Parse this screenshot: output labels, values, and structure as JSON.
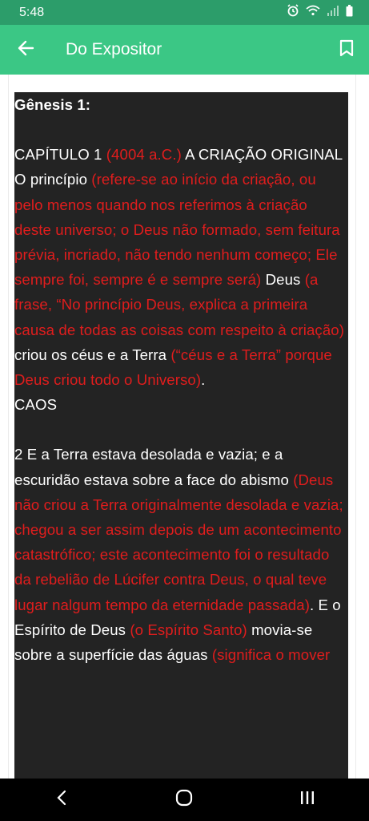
{
  "status_bar": {
    "time": "5:48",
    "icons": [
      "alarm-icon",
      "wifi-icon",
      "signal-icon",
      "battery-icon"
    ]
  },
  "app_bar": {
    "title": "Do Expositor",
    "back_icon": "arrow-left-icon",
    "bookmark_icon": "bookmark-icon",
    "color": "#3bc785"
  },
  "content": {
    "heading": "Gênesis 1:",
    "para1": [
      {
        "text": "CAPÍTULO 1 ",
        "red": false
      },
      {
        "text": "(4004 a.C.)",
        "red": true
      },
      {
        "text": " A CRIAÇÃO ORIGINAL O princípio ",
        "red": false
      },
      {
        "text": "(refere-se ao início da criação, ou pelo menos quando nos referimos à criação deste universo; o Deus não formado, sem feitura prévia, incriado, não tendo nenhum começo; Ele sempre foi, sempre é e sempre será)",
        "red": true
      },
      {
        "text": " Deus ",
        "red": false
      },
      {
        "text": "(a frase, “No princípio Deus, explica a primeira causa de todas as coisas com respeito à criação)",
        "red": true
      },
      {
        "text": " criou os céus e a Terra ",
        "red": false
      },
      {
        "text": "(“céus e a Terra” porque Deus criou todo o Universo)",
        "red": true
      },
      {
        "text": ".",
        "red": false
      }
    ],
    "caos": "CAOS",
    "para2": [
      {
        "text": "2 E a Terra estava desolada e vazia; e a escuridão estava sobre a face do abismo ",
        "red": false
      },
      {
        "text": "(Deus não criou a Terra originalmente desolada e vazia; chegou a ser assim depois de um acontecimento catastrófico; este acontecimento foi o resultado da rebelião de Lúcifer contra Deus, o qual teve lugar nalgum tempo da eternidade passada)",
        "red": true
      },
      {
        "text": ". E o Espírito de Deus ",
        "red": false
      },
      {
        "text": "(o Espírito Santo)",
        "red": true
      },
      {
        "text": " movia-se sobre a superfície das águas ",
        "red": false
      },
      {
        "text": "(significa o mover",
        "red": true
      }
    ]
  },
  "nav_bar": {
    "buttons": [
      "back-nav-icon",
      "home-nav-icon",
      "recents-nav-icon"
    ]
  }
}
